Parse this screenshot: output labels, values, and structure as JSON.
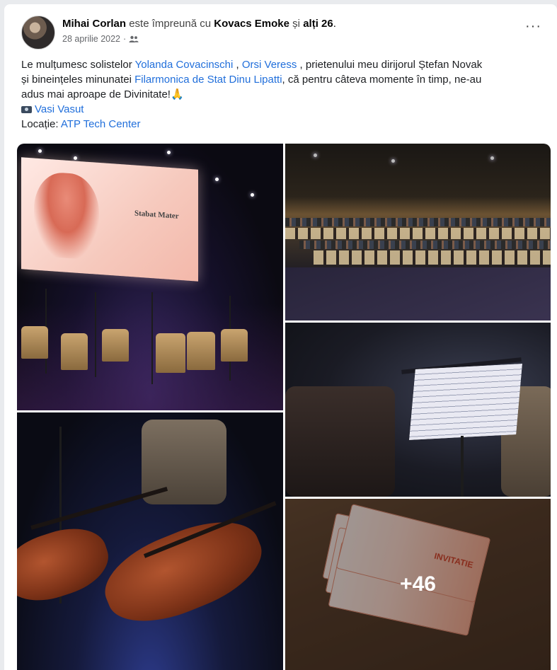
{
  "post": {
    "author": "Mihai Corlan",
    "with_text": "este împreună cu",
    "tagged": "Kovacs Emoke",
    "and_text": "și",
    "others": "alți 26",
    "period": ".",
    "date": "28 aprilie 2022",
    "dot": "·",
    "audience_icon": "friends-icon",
    "more_label": "···"
  },
  "body": {
    "p1_a": "Le mulțumesc solistelor ",
    "link_yolanda": "Yolanda Covacinschi",
    "p1_b": " , ",
    "link_orsi": "Orsi Veress",
    "p1_c": " , prietenului meu dirijorul Ștefan Novak",
    "p2_a": "și bineințeles minunatei ",
    "link_filarmonica": "Filarmonica de Stat Dinu Lipatti",
    "p2_b": ", că pentru câteva momente în timp, ne-au",
    "p3": "adus mai aproape de Divinitate!🙏",
    "camera_icon": "camera-icon",
    "photographer": "Vasi Vasut",
    "location_label": "Locație: ",
    "location": "ATP Tech Center"
  },
  "photos": {
    "screen_title": "Stabat Mater",
    "screen_sub": "",
    "more_count": "+46",
    "ticket_label": "INVITATIE"
  },
  "colors": {
    "link": "#216fdb",
    "text": "#1c1e21",
    "meta": "#65676b"
  }
}
